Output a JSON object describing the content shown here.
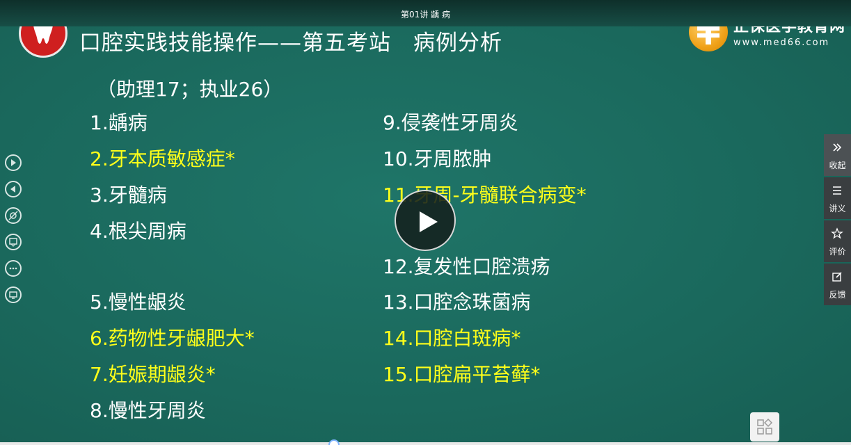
{
  "window": {
    "title": "第01讲  龋  病"
  },
  "slide": {
    "title": "口腔实践技能操作——第五考站　病例分析",
    "subtitle": "（助理17；执业26）",
    "items_left": [
      {
        "text": "1.龋病",
        "highlight": false
      },
      {
        "text": "2.牙本质敏感症*",
        "highlight": true
      },
      {
        "text": "3.牙髓病",
        "highlight": false
      },
      {
        "text": "4.根尖周病",
        "highlight": false
      },
      {
        "text": "5.慢性龈炎",
        "highlight": false
      },
      {
        "text": "6.药物性牙龈肥大*",
        "highlight": true
      },
      {
        "text": "7.妊娠期龈炎*",
        "highlight": true
      },
      {
        "text": "8.慢性牙周炎",
        "highlight": false
      }
    ],
    "items_right": [
      {
        "text": "9.侵袭性牙周炎",
        "highlight": false
      },
      {
        "text": "10.牙周脓肿",
        "highlight": false
      },
      {
        "text": "11.牙周-牙髓联合病变*",
        "highlight": true
      },
      {
        "text": "12.复发性口腔溃疡",
        "highlight": false
      },
      {
        "text": "13.口腔念珠菌病",
        "highlight": false
      },
      {
        "text": "14.口腔白斑病*",
        "highlight": true
      },
      {
        "text": "15.口腔扁平苔藓*",
        "highlight": true
      }
    ]
  },
  "brand": {
    "name": "正保医学教育网",
    "url": "www.med66.com"
  },
  "player": {
    "play_icon": "play-icon",
    "left_tools": [
      "next-icon",
      "prev-icon",
      "hide-annotation-icon",
      "whiteboard-icon",
      "more-icon",
      "screen-icon"
    ]
  },
  "right_panel": {
    "collapse": "收起",
    "handout": "讲义",
    "rate": "评价",
    "feedback": "反馈"
  },
  "colors": {
    "highlight": "#ffff1a",
    "background": "#1c6a5e",
    "logo_red": "#cf1f1f",
    "brand_gold": "#f0a21a"
  }
}
